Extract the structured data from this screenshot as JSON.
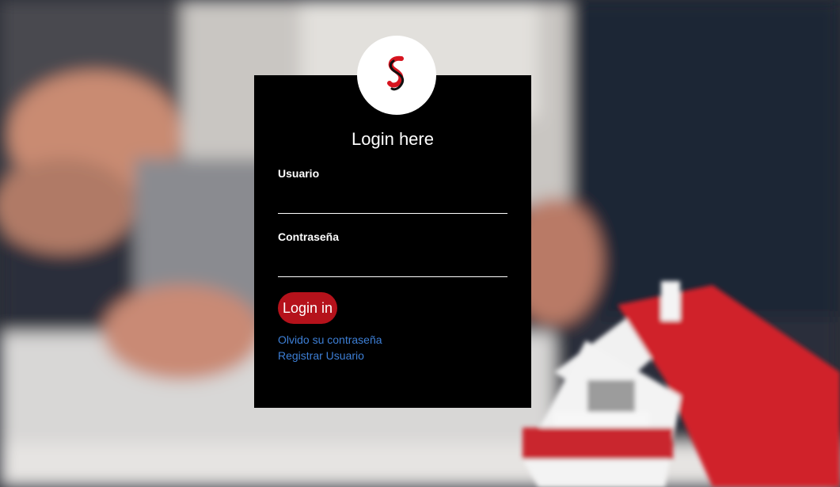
{
  "colors": {
    "card_background": "#000000",
    "accent": "#b5121b",
    "link": "#3d7fd6",
    "text": "#ffffff"
  },
  "background": {
    "icon": "office-meeting-house-model-photo"
  },
  "logo": {
    "icon": "s-logo-icon"
  },
  "form": {
    "title": "Login here",
    "username_label": "Usuario",
    "username_value": "",
    "password_label": "Contraseña",
    "password_value": "",
    "login_button": "Login in",
    "forgot_password_link": "Olvido su contraseña",
    "register_link": "Registrar Usuario"
  }
}
